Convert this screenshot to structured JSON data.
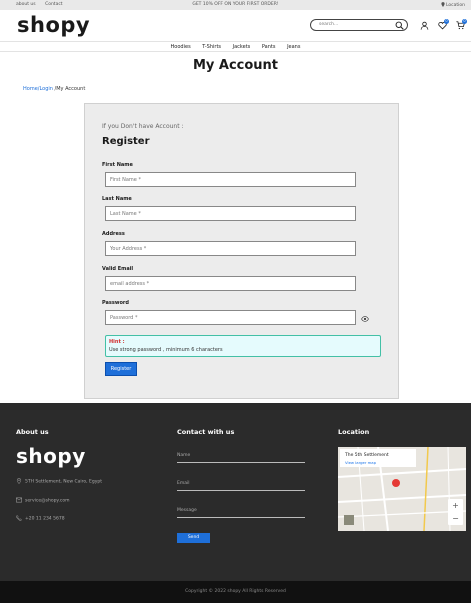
{
  "topbar": {
    "about": "about us",
    "contact": "Contact",
    "promo": "GET 10% OFF ON YOUR FIRST ORDER!",
    "location": "Location"
  },
  "header": {
    "logo": "shopy",
    "search_placeholder": "search...",
    "wishlist_count": "0",
    "cart_count": "0"
  },
  "nav": [
    "Hoodies",
    "T-Shirts",
    "Jackets",
    "Pants",
    "Jeans"
  ],
  "page_title": "My Account",
  "breadcrumb": {
    "home": "Home",
    "login": "/Login",
    "current": " /My Account"
  },
  "register": {
    "subtitle": "If you Don't have Account :",
    "title": "Register",
    "fields": [
      {
        "label": "First Name",
        "placeholder": "First Name *"
      },
      {
        "label": "Last Name",
        "placeholder": "Last Name *"
      },
      {
        "label": "Address",
        "placeholder": "Your Address *"
      },
      {
        "label": "Valid Email",
        "placeholder": "email address *"
      },
      {
        "label": "Password",
        "placeholder": "Password *"
      }
    ],
    "hint_title": "Hint :",
    "hint_text": "Use strong password , minimum 6 characters",
    "button": "Register"
  },
  "footer": {
    "about_heading": "About us",
    "logo": "shopy",
    "address": "5TH Settlement, New Cairo, Egypt",
    "email": "service@shopy.com",
    "phone": "+20 11 234 5678",
    "contact_heading": "Contact with us",
    "name_placeholder": "Name",
    "email_placeholder": "Email",
    "message_placeholder": "Message",
    "send": "Send",
    "location_heading": "Location",
    "map_place": "The 5th Settlement",
    "map_link": "View larger map",
    "copyright": "Copyright © 2022 shopy All Rights Reserved"
  },
  "colors": {
    "accent": "#1e6fd9",
    "footer_bg": "#2b2b2b",
    "hint_bg": "#e5fbfd",
    "hint_border": "#43c0a6",
    "hint_title": "#d32f2f"
  },
  "icons": [
    "search-icon",
    "user-icon",
    "heart-icon",
    "cart-icon",
    "location-icon",
    "eye-icon",
    "pin-icon",
    "mail-icon",
    "phone-icon"
  ]
}
